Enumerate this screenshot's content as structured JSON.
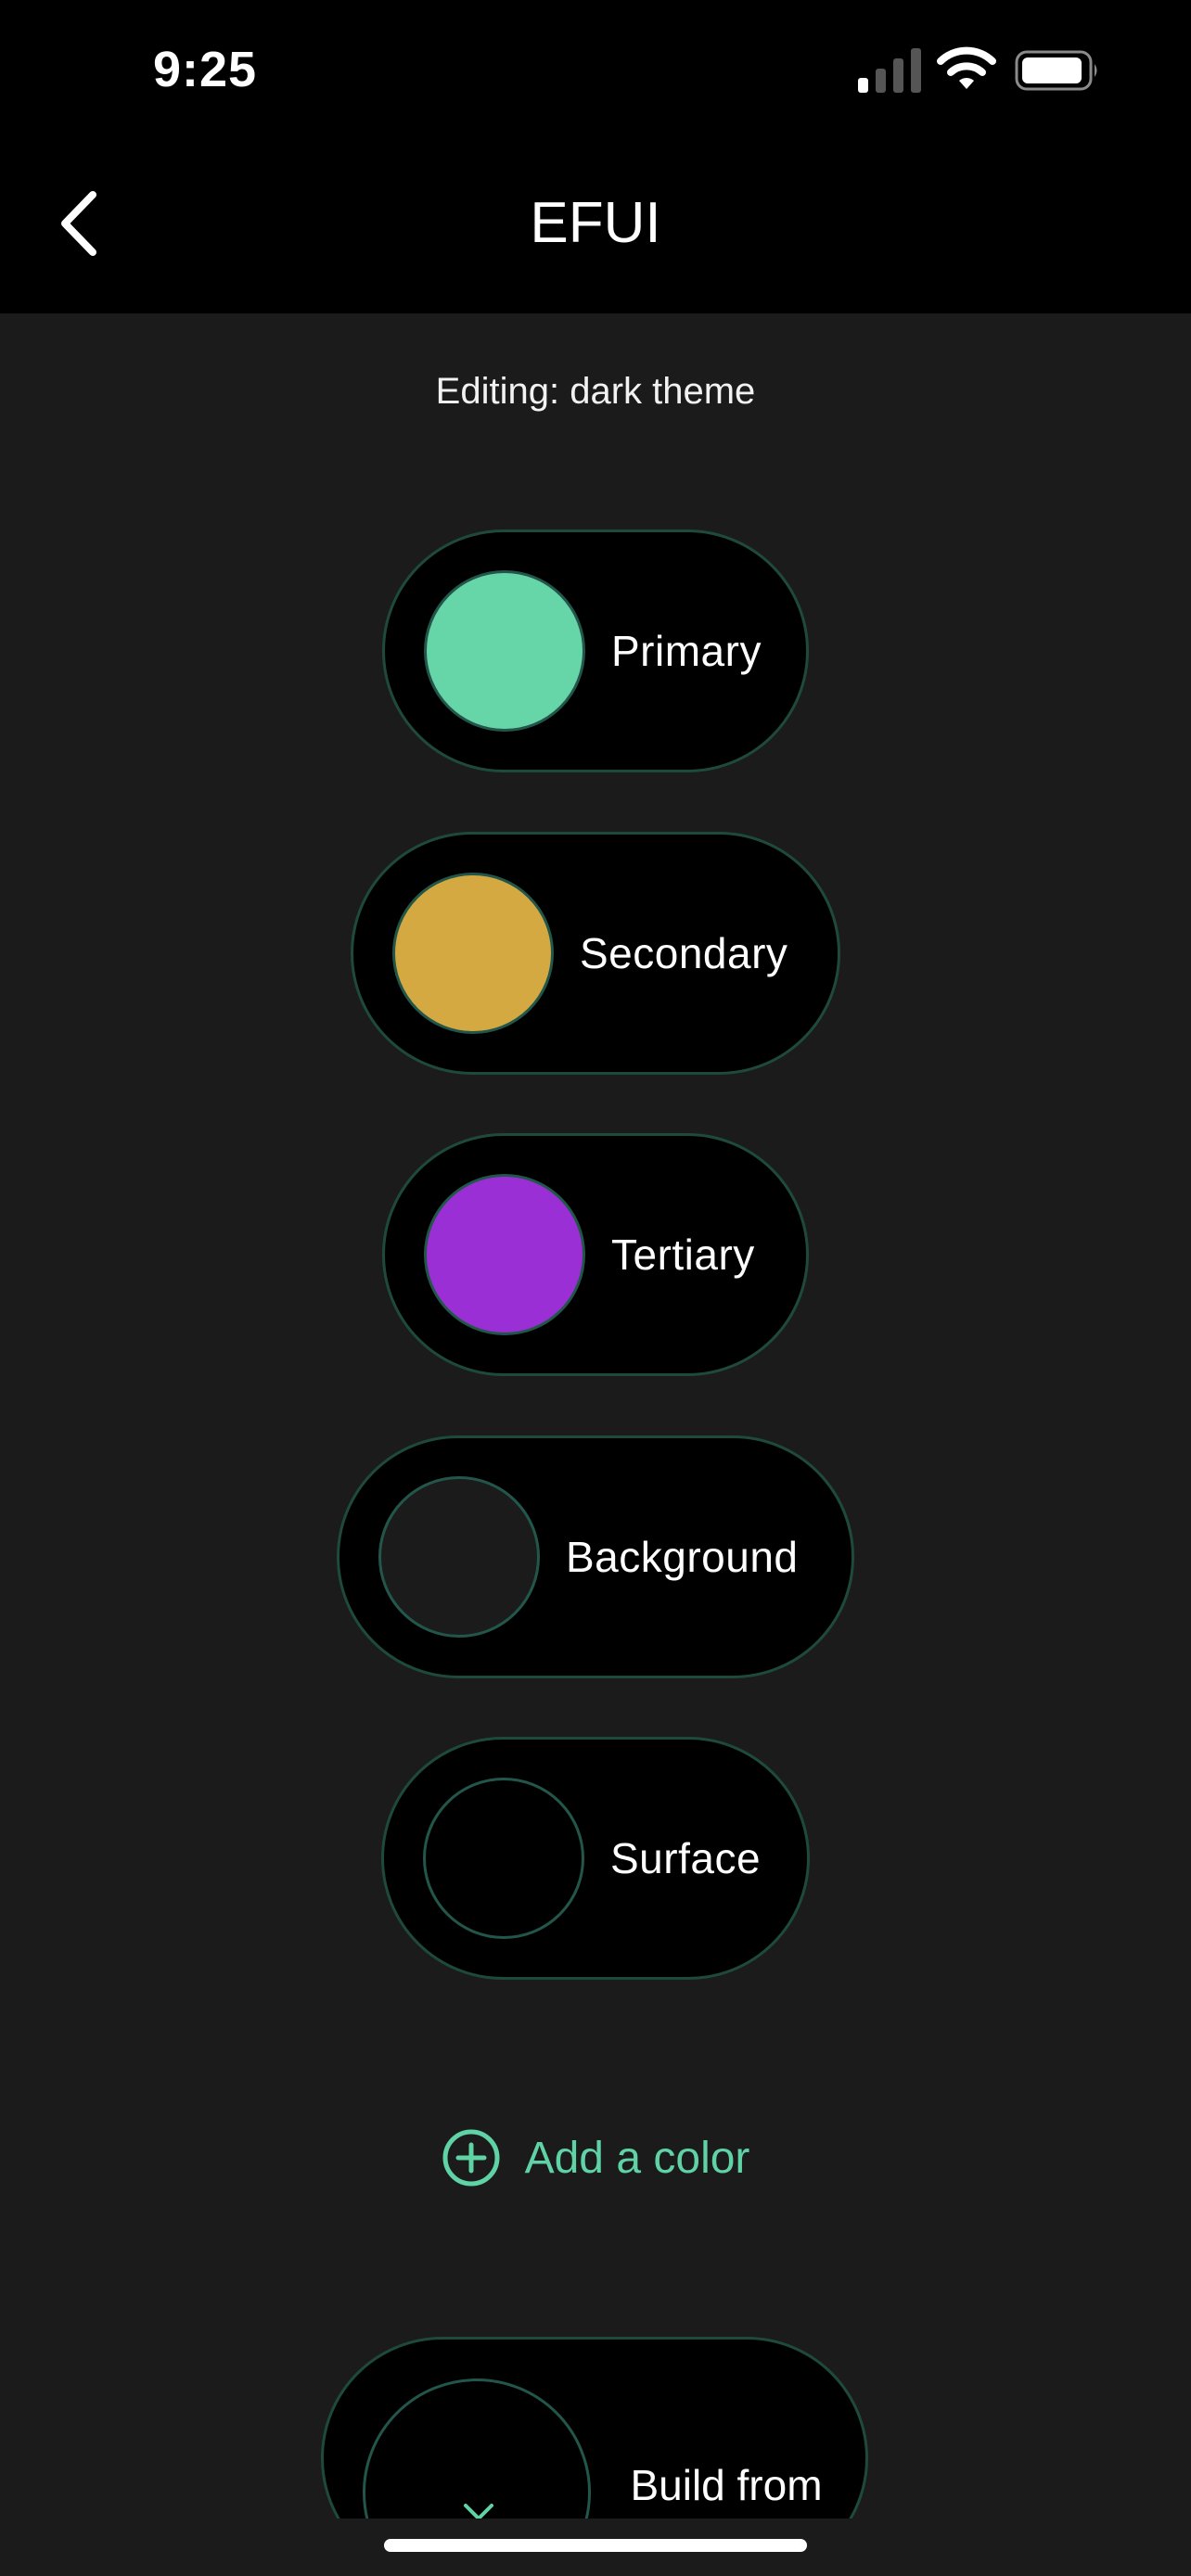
{
  "status_bar": {
    "time": "9:25",
    "icons": [
      "cellular-signal-icon",
      "wifi-icon",
      "battery-icon"
    ]
  },
  "nav": {
    "back_icon": "chevron-left-icon",
    "title": "EFUI"
  },
  "subtitle": "Editing: dark theme",
  "colors": [
    {
      "label": "Primary",
      "swatch": "#66d6a8"
    },
    {
      "label": "Secondary",
      "swatch": "#d4a942"
    },
    {
      "label": "Tertiary",
      "swatch": "#9b2fd6"
    },
    {
      "label": "Background",
      "swatch": "#1b1b1b"
    },
    {
      "label": "Surface",
      "swatch": "#000000"
    }
  ],
  "add_color": {
    "icon": "plus-circle-icon",
    "label": "Add a color"
  },
  "build_from_image": {
    "icon": "close-icon",
    "label": "Build from image"
  },
  "theme": {
    "accent": "#5fd3a5",
    "pill_border": "#1e4a3c",
    "background": "#1b1b1b"
  }
}
